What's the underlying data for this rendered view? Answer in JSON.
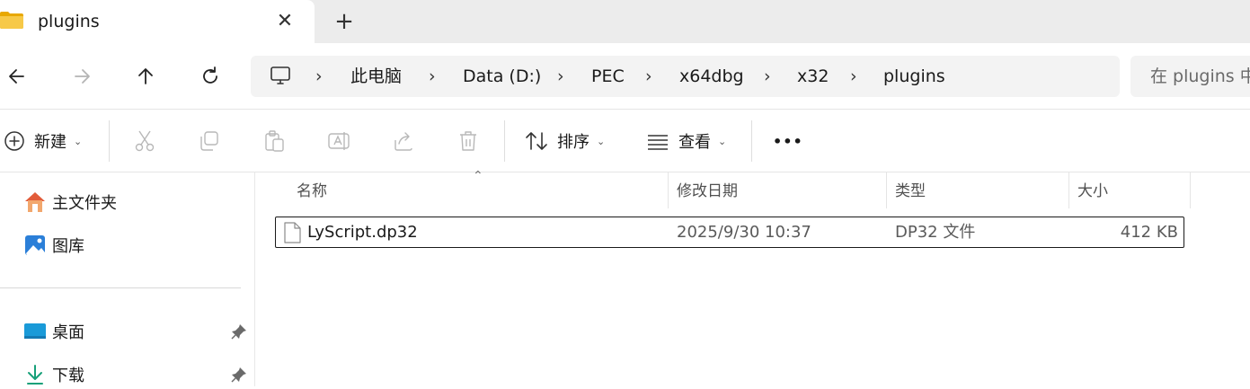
{
  "tab": {
    "title": "plugins",
    "close_glyph": "✕",
    "new_tab_glyph": "+"
  },
  "nav": {
    "back_icon": "arrow-left-icon",
    "forward_icon": "arrow-right-icon",
    "up_icon": "arrow-up-icon",
    "refresh_icon": "refresh-icon"
  },
  "breadcrumb": {
    "separator": "›",
    "items": [
      "此电脑",
      "Data (D:)",
      "PEC",
      "x64dbg",
      "x32",
      "plugins"
    ]
  },
  "search": {
    "placeholder": "在 plugins 中搜索"
  },
  "toolbar": {
    "new_label": "新建",
    "sort_label": "排序",
    "view_label": "查看",
    "more_label": "•••"
  },
  "sidebar": {
    "items": [
      {
        "label": "主文件夹",
        "icon": "home-icon"
      },
      {
        "label": "图库",
        "icon": "gallery-icon"
      },
      {
        "label": "桌面",
        "icon": "desktop-icon",
        "pinned": true
      },
      {
        "label": "下载",
        "icon": "download-icon",
        "pinned": true
      }
    ]
  },
  "columns": {
    "name": "名称",
    "modified": "修改日期",
    "type": "类型",
    "size": "大小"
  },
  "files": [
    {
      "name": "LyScript.dp32",
      "modified": "2025/9/30 10:37",
      "type": "DP32 文件",
      "size": "412 KB"
    }
  ],
  "colors": {
    "accent": "#0067c0",
    "folder": "#f5c342",
    "tabstrip": "#ececec",
    "address_bg": "#f3f3f3"
  }
}
